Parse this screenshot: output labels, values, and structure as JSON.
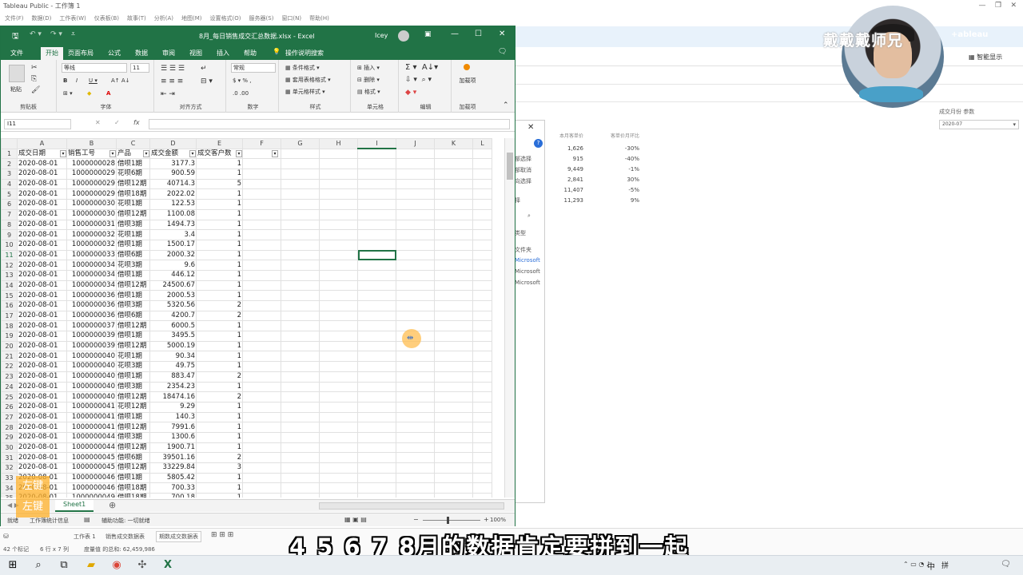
{
  "tableau": {
    "window_title": "Tableau Public - 工作簿 1",
    "menu": [
      "文件(F)",
      "数据(D)",
      "工作表(W)",
      "仪表板(B)",
      "故事(T)",
      "分析(A)",
      "地图(M)",
      "设置格式(O)",
      "服务器(S)",
      "窗口(N)",
      "帮助(H)"
    ],
    "smart_display": "智能显示",
    "param_title": "成交月份 参数",
    "param_value": "2020-07",
    "table_headers": [
      "本月客单价",
      "客单价月环比"
    ],
    "table_rows": [
      [
        "1,626",
        "-30%"
      ],
      [
        "915",
        "-40%"
      ],
      [
        "9,449",
        "-1%"
      ],
      [
        "2,841",
        "30%"
      ],
      [
        "11,407",
        "-5%"
      ],
      [
        "11,293",
        "9%"
      ]
    ],
    "dialog_items": [
      "部选择",
      "部取消",
      "向选择",
      "择",
      "类型",
      "文件夹",
      "Microsoft",
      "Microsoft",
      "Microsoft"
    ],
    "sheet_tabs": [
      "工作表 1",
      "销售成交数据表",
      "期数成交数据表"
    ],
    "status_left": "42 个标记",
    "status_dims": "6 行 x 7 列",
    "status_sum": "度量值 的总和: 62,459,986",
    "brand": "+ableau"
  },
  "watermark": "戴戴戴师兄",
  "excel": {
    "title": "8月_每日销售成交汇总数据.xlsx  -  Excel",
    "user": "Icey",
    "tabs": [
      "文件",
      "开始",
      "页面布局",
      "公式",
      "数据",
      "审阅",
      "视图",
      "插入",
      "帮助",
      "操作说明搜索"
    ],
    "active_tab": "开始",
    "ribbon": {
      "paste": "粘贴",
      "clipboard": "剪贴板",
      "font_name": "等线",
      "font_size": "11",
      "font_group": "字体",
      "align_group": "对齐方式",
      "number_format": "常规",
      "number_group": "数字",
      "cond_format": "条件格式",
      "table_format": "套用表格格式",
      "cell_style": "单元格样式",
      "style_group": "样式",
      "insert": "插入",
      "delete": "删除",
      "format": "格式",
      "cells_group": "单元格",
      "edit_group": "编辑",
      "addin": "加载项",
      "addin_group": "加载项"
    },
    "name_box": "I11",
    "fx": "fx",
    "columns": [
      "A",
      "B",
      "C",
      "D",
      "E",
      "F",
      "G",
      "H",
      "I",
      "J",
      "K",
      "L"
    ],
    "headers": [
      "成交日期",
      "销售工号",
      "产品",
      "成交金额",
      "成交客户数"
    ],
    "rows": [
      [
        "2020-08-01",
        "1000000028",
        "借呗1期",
        "3177.3",
        "1"
      ],
      [
        "2020-08-01",
        "1000000029",
        "花呗6期",
        "900.59",
        "1"
      ],
      [
        "2020-08-01",
        "1000000029",
        "借呗12期",
        "40714.3",
        "5"
      ],
      [
        "2020-08-01",
        "1000000029",
        "借呗18期",
        "2022.02",
        "1"
      ],
      [
        "2020-08-01",
        "1000000030",
        "花呗1期",
        "122.53",
        "1"
      ],
      [
        "2020-08-01",
        "1000000030",
        "借呗12期",
        "1100.08",
        "1"
      ],
      [
        "2020-08-01",
        "1000000031",
        "借呗3期",
        "1494.73",
        "1"
      ],
      [
        "2020-08-01",
        "1000000032",
        "花呗1期",
        "3.4",
        "1"
      ],
      [
        "2020-08-01",
        "1000000032",
        "借呗1期",
        "1500.17",
        "1"
      ],
      [
        "2020-08-01",
        "1000000033",
        "借呗6期",
        "2000.32",
        "1"
      ],
      [
        "2020-08-01",
        "1000000034",
        "花呗3期",
        "9.6",
        "1"
      ],
      [
        "2020-08-01",
        "1000000034",
        "借呗1期",
        "446.12",
        "1"
      ],
      [
        "2020-08-01",
        "1000000034",
        "借呗12期",
        "24500.67",
        "1"
      ],
      [
        "2020-08-01",
        "1000000036",
        "借呗1期",
        "2000.53",
        "1"
      ],
      [
        "2020-08-01",
        "1000000036",
        "借呗3期",
        "5320.56",
        "2"
      ],
      [
        "2020-08-01",
        "1000000036",
        "借呗6期",
        "4200.7",
        "2"
      ],
      [
        "2020-08-01",
        "1000000037",
        "借呗12期",
        "6000.5",
        "1"
      ],
      [
        "2020-08-01",
        "1000000039",
        "借呗1期",
        "3495.5",
        "1"
      ],
      [
        "2020-08-01",
        "1000000039",
        "借呗12期",
        "5000.19",
        "1"
      ],
      [
        "2020-08-01",
        "1000000040",
        "花呗1期",
        "90.34",
        "1"
      ],
      [
        "2020-08-01",
        "1000000040",
        "花呗3期",
        "49.75",
        "1"
      ],
      [
        "2020-08-01",
        "1000000040",
        "借呗1期",
        "883.47",
        "2"
      ],
      [
        "2020-08-01",
        "1000000040",
        "借呗3期",
        "2354.23",
        "1"
      ],
      [
        "2020-08-01",
        "1000000040",
        "借呗12期",
        "18474.16",
        "2"
      ],
      [
        "2020-08-01",
        "1000000041",
        "花呗12期",
        "9.29",
        "1"
      ],
      [
        "2020-08-01",
        "1000000041",
        "借呗1期",
        "140.3",
        "1"
      ],
      [
        "2020-08-01",
        "1000000041",
        "借呗12期",
        "7991.6",
        "1"
      ],
      [
        "2020-08-01",
        "1000000044",
        "借呗3期",
        "1300.6",
        "1"
      ],
      [
        "2020-08-01",
        "1000000044",
        "借呗12期",
        "1900.71",
        "1"
      ],
      [
        "2020-08-01",
        "1000000045",
        "借呗6期",
        "39501.16",
        "2"
      ],
      [
        "2020-08-01",
        "1000000045",
        "借呗12期",
        "33229.84",
        "3"
      ],
      [
        "2020-08-01",
        "1000000046",
        "借呗1期",
        "5805.42",
        "1"
      ],
      [
        "2020-08-01",
        "1000000046",
        "借呗18期",
        "700.33",
        "1"
      ],
      [
        "2020-08-01",
        "1000000049",
        "借呗18期",
        "700.18",
        "1"
      ]
    ],
    "sheet_tab": "Sheet1",
    "status_ready": "就绪",
    "status_stats": "工作簿统计信息",
    "status_access": "辅助功能: 一切就绪",
    "zoom": "100%"
  },
  "orange_badge": [
    "左键",
    "左键"
  ],
  "subtitle": "4 5 6 7 8月的数据肯定要拼到一起",
  "taskbar": {
    "ime": "中",
    "ime2": "拼"
  }
}
